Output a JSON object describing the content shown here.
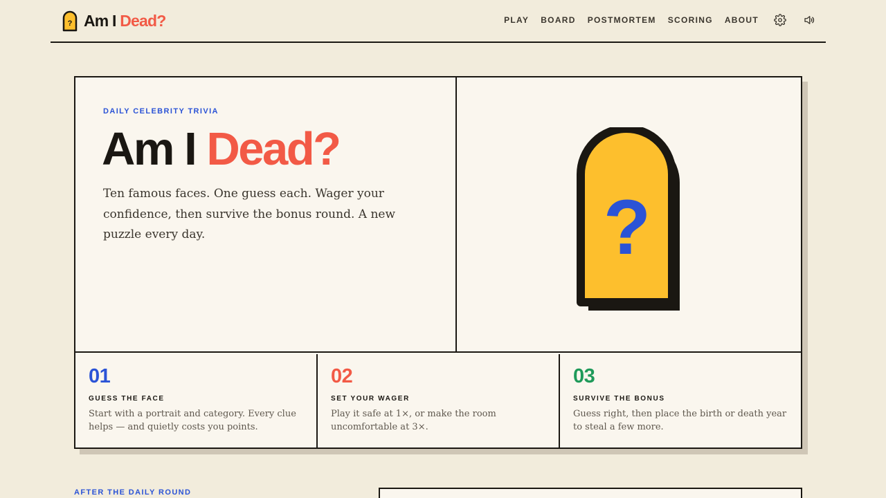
{
  "brand": {
    "name_part1": "Am I",
    "name_part2": "Dead?",
    "icon_glyph": "?"
  },
  "nav": {
    "items": [
      {
        "label": "PLAY"
      },
      {
        "label": "BOARD"
      },
      {
        "label": "POSTMORTEM"
      },
      {
        "label": "SCORING"
      },
      {
        "label": "ABOUT"
      }
    ],
    "icons": [
      "gear-icon",
      "speaker-icon"
    ]
  },
  "hero": {
    "eyebrow": "DAILY CELEBRITY TRIVIA",
    "title_part1": "Am I",
    "title_part2": "Dead?",
    "description": "Ten famous faces. One guess each. Wager your confidence, then survive the bonus round. A new puzzle every day.",
    "illustration_glyph": "?"
  },
  "steps": [
    {
      "number": "01",
      "title": "GUESS THE FACE",
      "description": "Start with a portrait and category. Every clue helps — and quietly costs you points.",
      "color": "#2b53d6"
    },
    {
      "number": "02",
      "title": "SET YOUR WAGER",
      "description": "Play it safe at 1×, or make the room uncomfortable at 3×.",
      "color": "#f25a46"
    },
    {
      "number": "03",
      "title": "SURVIVE THE BONUS",
      "description": "Guess right, then place the birth or death year to steal a few more.",
      "color": "#1f9a5a"
    }
  ],
  "after_section": {
    "label": "AFTER THE DAILY ROUND"
  },
  "colors": {
    "background": "#f2ecdc",
    "card": "#faf6ee",
    "ink": "#1a1712",
    "accent_red": "#f25a46",
    "accent_blue": "#2b53d6",
    "accent_green": "#1f9a5a",
    "tomb_yellow": "#fdbf2d"
  }
}
